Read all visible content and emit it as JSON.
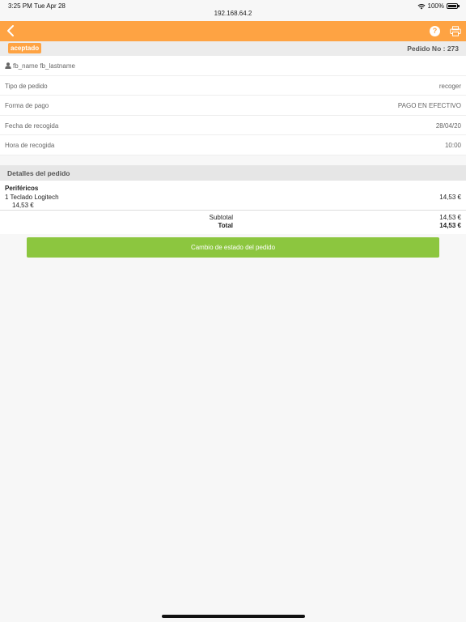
{
  "status_bar": {
    "time": "3:25 PM",
    "date": "Tue Apr 28",
    "url": "192.168.64.2",
    "battery": "100%",
    "icons": [
      "wifi-icon",
      "battery-icon"
    ]
  },
  "navbar": {
    "color": "#fea343",
    "icons": [
      "chevron-left-icon",
      "help-icon",
      "print-icon"
    ],
    "help_glyph": "?"
  },
  "order": {
    "status_badge": "aceptado",
    "number": "Pedido No : 273"
  },
  "info": {
    "customer": "fb_name fb_lastname",
    "rows": [
      {
        "label": "Tipo de pedido",
        "value": "recoger"
      },
      {
        "label": "Forma de pago",
        "value": "PAGO EN EFECTIVO"
      },
      {
        "label": "Fecha de recogida",
        "value": "28/04/20"
      },
      {
        "label": "Hora de recogida",
        "value": "10:00"
      }
    ]
  },
  "details": {
    "header": "Detalles del pedido",
    "category": "Periféricos",
    "item": {
      "qty": "1",
      "name": "Teclado Logitech",
      "line": "1  Teclado Logitech",
      "price": "14,53 €",
      "unit_price": "14,53 €"
    },
    "subtotal_label": "Subtotal",
    "subtotal_value": "14,53 €",
    "total_label": "Total",
    "total_value": "14,53 €"
  },
  "action": {
    "label": "Cambio de estado del pedido",
    "color": "#8cc63f"
  }
}
